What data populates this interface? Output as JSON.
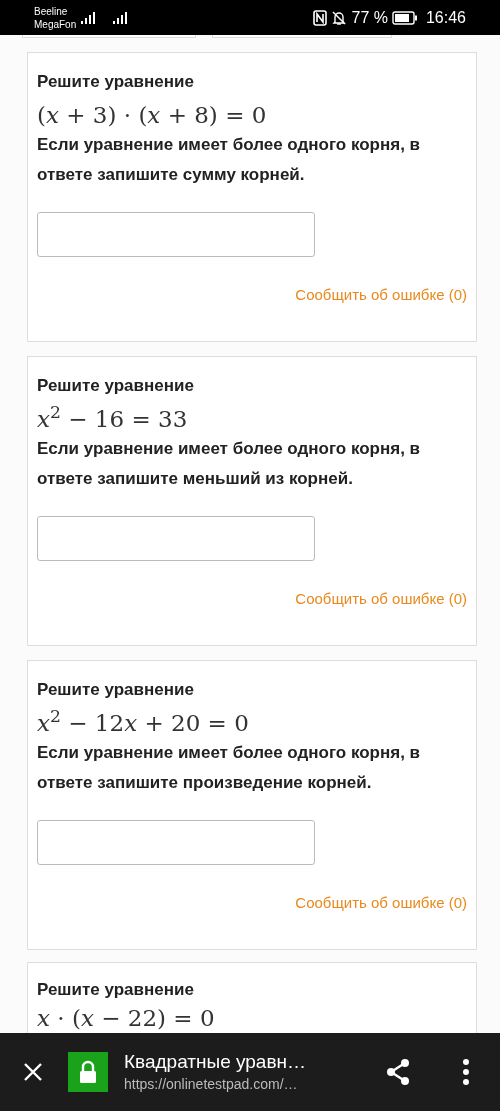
{
  "status_bar": {
    "carriers": [
      "Beeline",
      "MegaFon"
    ],
    "battery": "77 %",
    "time": "16:46"
  },
  "questions": [
    {
      "title": "Решите уравнение",
      "equation": "(𝑥 + 3) · (𝑥 + 8) = 0",
      "instruction": "Если уравнение имеет более одного корня, в ответе запишите сумму  корней.",
      "report_link": "Сообщить об ошибке (0)"
    },
    {
      "title": "Решите уравнение",
      "equation": "𝑥$^{2}$ − 16 = 33",
      "instruction": "Если уравнение имеет более одного корня, в ответе запишите меньший из корней.",
      "report_link": "Сообщить об ошибке (0)"
    },
    {
      "title": "Решите уравнение",
      "equation": "𝑥$^{2}$ − 12𝑥 + 20 = 0",
      "instruction": "Если уравнение имеет более одного корня, в ответе запишите произведение корней.",
      "report_link": "Сообщить об ошибке (0)"
    },
    {
      "title": "Решите уравнение",
      "equation": "𝑥 · (𝑥 − 22) = 0"
    }
  ],
  "browser_bar": {
    "title": "Квадратные уравн…",
    "url": "https://onlinetestpad.com/…"
  }
}
